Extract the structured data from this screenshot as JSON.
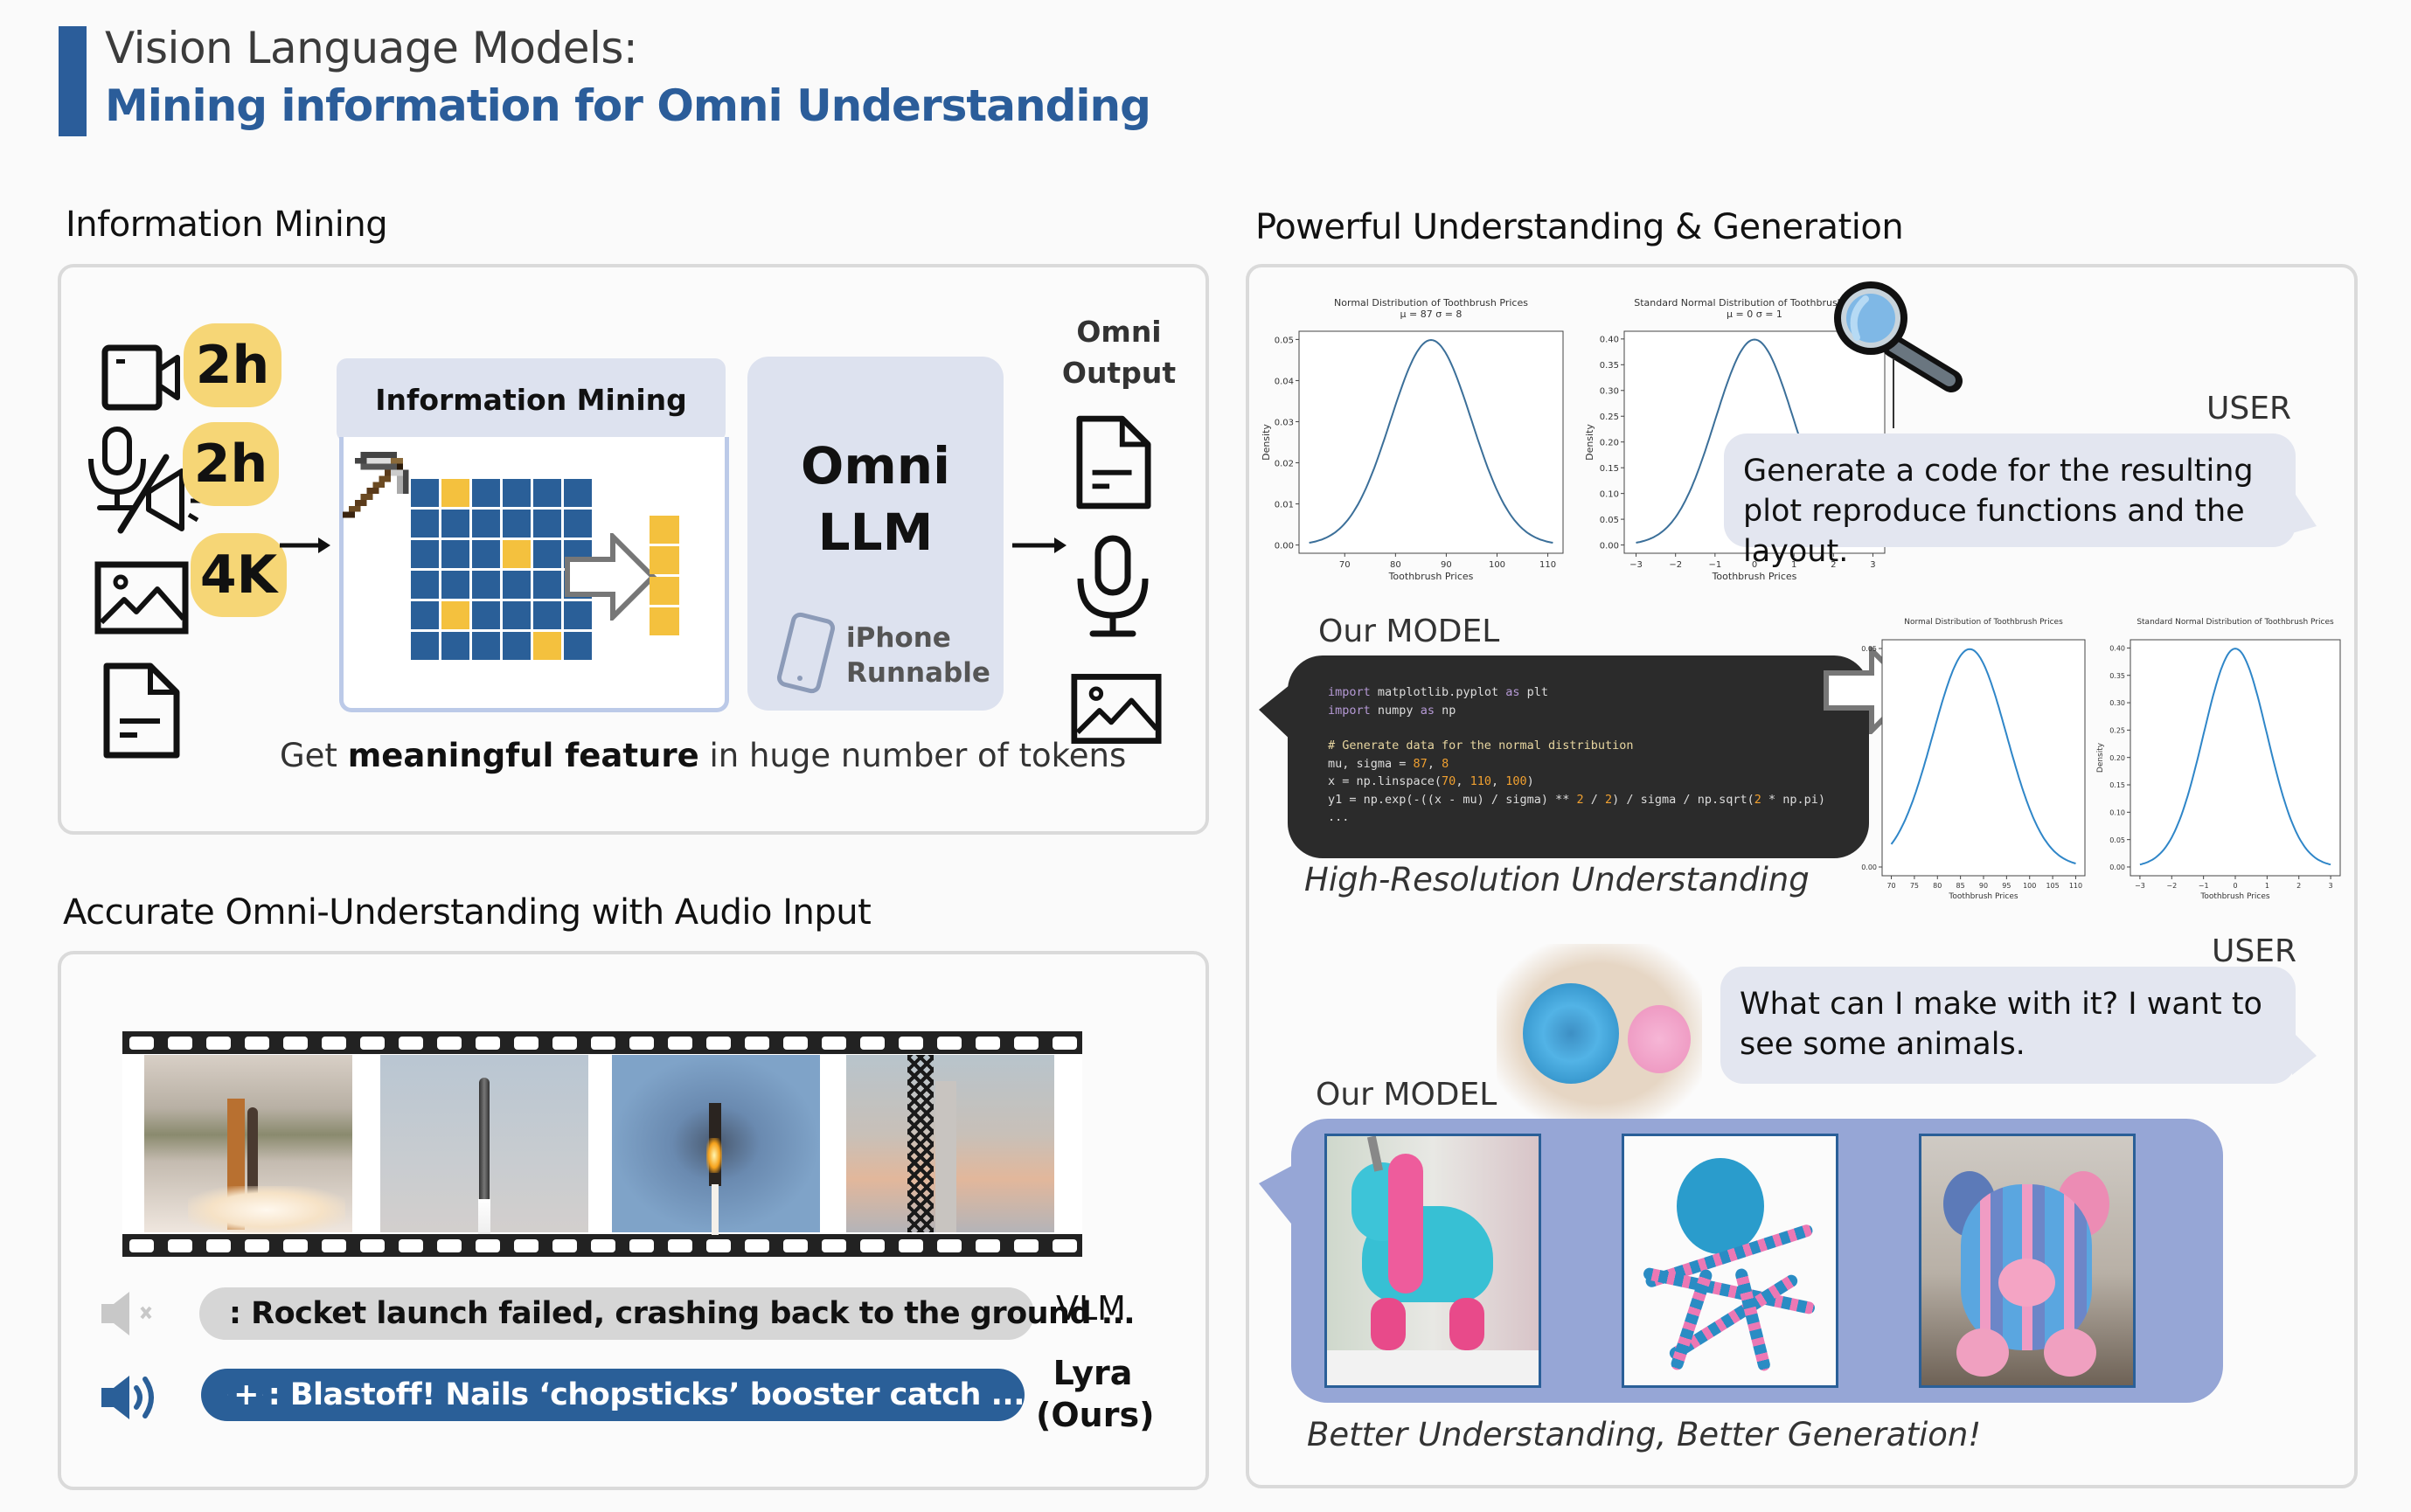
{
  "header": {
    "title_line1": "Vision Language Models:",
    "title_line2": "Mining information for Omni Understanding",
    "accent_color": "#2b5d9a"
  },
  "info_mining": {
    "section_title": "Information Mining",
    "inputs": [
      {
        "icon": "video-camera-icon",
        "badge": "2h"
      },
      {
        "icon": "audio-mic-speaker-icon",
        "badge": "2h"
      },
      {
        "icon": "image-icon",
        "badge": "4K"
      },
      {
        "icon": "document-icon",
        "badge": ""
      }
    ],
    "mining_block_title": "Information Mining",
    "token_grid": {
      "rows": 6,
      "cols": 6,
      "highlighted": [
        [
          0,
          1
        ],
        [
          2,
          3
        ],
        [
          4,
          1
        ],
        [
          5,
          4
        ]
      ],
      "selected_tokens": 4
    },
    "llm_line1": "Omni",
    "llm_line2": "LLM",
    "iphone_line1": "iPhone",
    "iphone_line2": "Runnable",
    "output_title_line1": "Omni",
    "output_title_line2": "Output",
    "outputs": [
      "document-icon",
      "microphone-icon",
      "image-icon"
    ],
    "caption_prefix": "Get ",
    "caption_bold": "meaningful feature",
    "caption_suffix": " in huge number of tokens"
  },
  "audio_section": {
    "section_title": "Accurate Omni-Understanding with Audio Input",
    "frames": [
      "rocket-launch-tower-frame",
      "rocket-ascent-frame",
      "booster-descent-flame-frame",
      "tower-catch-frame"
    ],
    "rows": [
      {
        "speaker_icon": "speaker-muted-icon",
        "modality": "text-icon",
        "text": ": Rocket launch failed, crashing back to the ground ...",
        "label": "VLM"
      },
      {
        "speaker_icon": "speaker-on-icon",
        "modality": "text-plus-speech-icon",
        "text": ": Blastoff! Nails ‘chopsticks’ booster catch ...",
        "label_line1": "Lyra",
        "label_line2": "(Ours)"
      }
    ]
  },
  "generation_section": {
    "section_title": "Powerful Understanding & Generation",
    "user_label": "USER",
    "prompt1": "Generate a code for the resulting plot reproduce functions and the layout.",
    "model_label": "Our MODEL",
    "code_lines": [
      {
        "parts": [
          {
            "t": "import",
            "c": "kw"
          },
          {
            "t": " matplotlib.pyplot ",
            "c": ""
          },
          {
            "t": "as",
            "c": "kw"
          },
          {
            "t": " plt",
            "c": ""
          }
        ]
      },
      {
        "parts": [
          {
            "t": "import",
            "c": "kw"
          },
          {
            "t": " numpy ",
            "c": ""
          },
          {
            "t": "as",
            "c": "kw"
          },
          {
            "t": " np",
            "c": ""
          }
        ]
      },
      {
        "parts": [
          {
            "t": "",
            "c": ""
          }
        ]
      },
      {
        "parts": [
          {
            "t": "# Generate data for the normal distribution",
            "c": "cm"
          }
        ]
      },
      {
        "parts": [
          {
            "t": "mu, sigma = ",
            "c": ""
          },
          {
            "t": "87",
            "c": "num"
          },
          {
            "t": ", ",
            "c": ""
          },
          {
            "t": "8",
            "c": "num"
          }
        ]
      },
      {
        "parts": [
          {
            "t": "x = np.linspace(",
            "c": ""
          },
          {
            "t": "70",
            "c": "num"
          },
          {
            "t": ", ",
            "c": ""
          },
          {
            "t": "110",
            "c": "num"
          },
          {
            "t": ", ",
            "c": ""
          },
          {
            "t": "100",
            "c": "num"
          },
          {
            "t": ")",
            "c": ""
          }
        ]
      },
      {
        "parts": [
          {
            "t": "y1 = np.exp(-((x - mu) / sigma) ** ",
            "c": ""
          },
          {
            "t": "2",
            "c": "num"
          },
          {
            "t": " / ",
            "c": ""
          },
          {
            "t": "2",
            "c": "num"
          },
          {
            "t": ") / sigma / np.sqrt(",
            "c": ""
          },
          {
            "t": "2",
            "c": "num"
          },
          {
            "t": " * np.pi)",
            "c": ""
          }
        ]
      },
      {
        "parts": [
          {
            "t": "...",
            "c": ""
          }
        ]
      }
    ],
    "caption1": "High-Resolution Understanding",
    "user_label2": "USER",
    "prompt2": "What can I make with it? I want to see some animals.",
    "model_label2": "Our MODEL",
    "generated_images": [
      "crochet-unicorn-image",
      "crochet-octopus-image",
      "crochet-bear-image"
    ],
    "caption2": "Better Understanding, Better Generation!"
  },
  "chart_data": [
    {
      "id": "input-left",
      "type": "line",
      "title": "Normal Distribution of Toothbrush Prices",
      "subtitle": "μ = 87 σ = 8",
      "xlabel": "Toothbrush Prices",
      "ylabel": "Density",
      "mu": 87,
      "sigma": 8,
      "xlim": [
        61,
        113
      ],
      "ylim": [
        -0.002,
        0.052
      ],
      "x_range": [
        63,
        111
      ],
      "xticks": [
        70,
        80,
        90,
        100,
        110
      ],
      "yticks": [
        0.0,
        0.01,
        0.02,
        0.03,
        0.04,
        0.05
      ],
      "ytick_labels": [
        "0.00",
        "0.01",
        "0.02",
        "0.03",
        "0.04",
        "0.05"
      ],
      "color": "#3b6f99"
    },
    {
      "id": "input-right",
      "type": "line",
      "title": "Standard Normal Distribution of Toothbrush Prices",
      "subtitle": "μ = 0 σ = 1",
      "xlabel": "Toothbrush Prices",
      "ylabel": "Density",
      "mu": 0,
      "sigma": 1,
      "xlim": [
        -3.3,
        3.3
      ],
      "ylim": [
        -0.016,
        0.415
      ],
      "x_range": [
        -3,
        3
      ],
      "xticks": [
        -3,
        -2,
        -1,
        0,
        1,
        2,
        3
      ],
      "yticks": [
        0.0,
        0.05,
        0.1,
        0.15,
        0.2,
        0.25,
        0.3,
        0.35,
        0.4
      ],
      "ytick_labels": [
        "0.00",
        "0.05",
        "0.10",
        "0.15",
        "0.20",
        "0.25",
        "0.30",
        "0.35",
        "0.40"
      ],
      "color": "#3b6f99"
    },
    {
      "id": "output-left",
      "type": "line",
      "title": "Normal Distribution of Toothbrush Prices",
      "subtitle": "",
      "xlabel": "Toothbrush Prices",
      "ylabel": "",
      "mu": 87,
      "sigma": 8,
      "xlim": [
        68,
        112
      ],
      "ylim": [
        -0.002,
        0.052
      ],
      "x_range": [
        70,
        110
      ],
      "xticks": [
        70,
        75,
        80,
        85,
        90,
        95,
        100,
        105,
        110
      ],
      "yticks": [
        0.0,
        0.05
      ],
      "ytick_labels": [
        "0.00",
        "0.05"
      ],
      "color": "#2f86c8"
    },
    {
      "id": "output-right",
      "type": "line",
      "title": "Standard Normal Distribution of Toothbrush Prices",
      "subtitle": "",
      "xlabel": "Toothbrush Prices",
      "ylabel": "Density",
      "mu": 0,
      "sigma": 1,
      "xlim": [
        -3.3,
        3.3
      ],
      "ylim": [
        -0.016,
        0.415
      ],
      "x_range": [
        -3,
        3
      ],
      "xticks": [
        -3,
        -2,
        -1,
        0,
        1,
        2,
        3
      ],
      "yticks": [
        0.0,
        0.05,
        0.1,
        0.15,
        0.2,
        0.25,
        0.3,
        0.35,
        0.4
      ],
      "ytick_labels": [
        "0.00",
        "0.05",
        "0.10",
        "0.15",
        "0.20",
        "0.25",
        "0.30",
        "0.35",
        "0.40"
      ],
      "color": "#2f86c8"
    }
  ]
}
